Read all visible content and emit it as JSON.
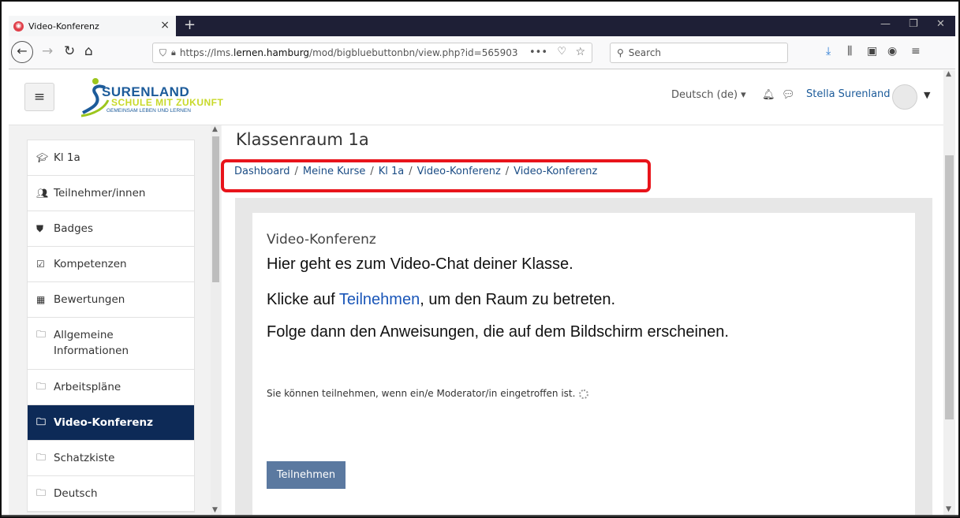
{
  "browser": {
    "tab_title": "Video-Konferenz",
    "tab_close": "×",
    "new_tab": "+",
    "url_prefix": "https://lms.",
    "url_host": "lernen.hamburg",
    "url_path": "/mod/bigbluebuttonbn/view.php?id=565903",
    "search_placeholder": "Search"
  },
  "header": {
    "logo_name": "SURENLAND",
    "logo_slogan": "SCHULE MIT ZUKUNFT",
    "logo_tagline": "GEMEINSAM LEBEN UND LERNEN",
    "language": "Deutsch (de)",
    "user_name": "Stella Surenland"
  },
  "sidebar": {
    "items": [
      {
        "label": "Kl 1a",
        "icon": "graduation-cap-icon"
      },
      {
        "label": "Teilnehmer/innen",
        "icon": "users-icon"
      },
      {
        "label": "Badges",
        "icon": "shield-icon"
      },
      {
        "label": "Kompetenzen",
        "icon": "checkbox-icon"
      },
      {
        "label": "Bewertungen",
        "icon": "table-icon"
      },
      {
        "label": "Allgemeine Informationen",
        "icon": "folder-icon"
      },
      {
        "label": "Arbeitspläne",
        "icon": "folder-icon"
      },
      {
        "label": "Video-Konferenz",
        "icon": "folder-icon",
        "active": true
      },
      {
        "label": "Schatzkiste",
        "icon": "folder-icon"
      },
      {
        "label": "Deutsch",
        "icon": "folder-icon"
      }
    ]
  },
  "main": {
    "page_title": "Klassenraum 1a",
    "breadcrumb": [
      "Dashboard",
      "Meine Kurse",
      "Kl 1a",
      "Video-Konferenz",
      "Video-Konferenz"
    ],
    "breadcrumb_sep": "/",
    "card_title": "Video-Konferenz",
    "intro_line1": "Hier geht es zum Video-Chat deiner Klasse.",
    "intro_line2_before": "Klicke auf ",
    "intro_line2_link": "Teilnehmen",
    "intro_line2_after": ", um den Raum zu betreten.",
    "intro_line3": "Folge dann den Anweisungen, die auf dem Bildschirm erscheinen.",
    "wait_text": "Sie können teilnehmen, wenn ein/e Moderator/in eingetroffen ist.",
    "join_button": "Teilnehmen"
  },
  "colors": {
    "nav_active": "#0d2a57",
    "link": "#1c4d85",
    "highlight": "#e8141b",
    "button": "#5b79a0"
  }
}
